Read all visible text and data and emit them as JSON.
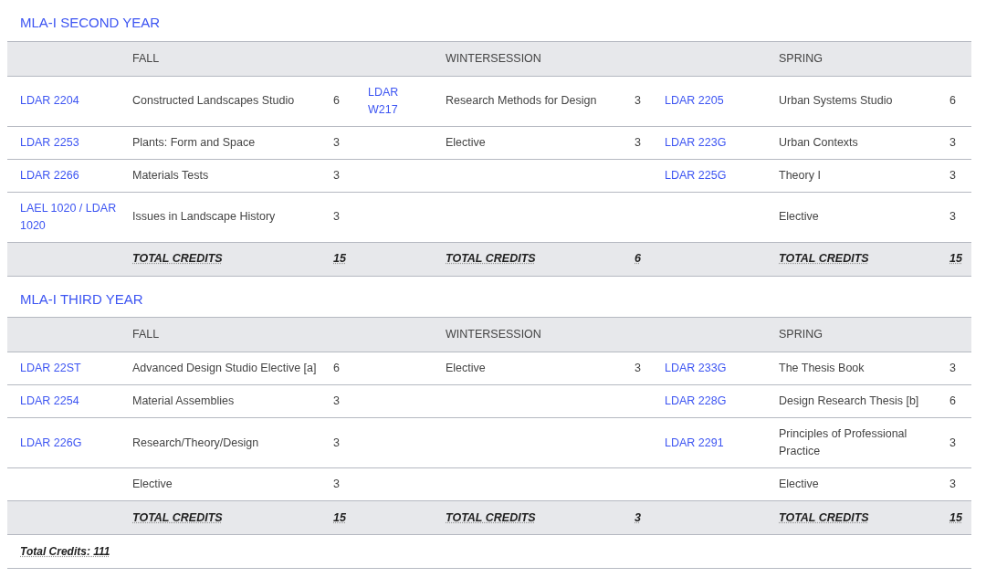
{
  "sections": [
    {
      "title": "MLA-I SECOND YEAR",
      "columns": [
        "FALL",
        "WINTERSESSION",
        "SPRING"
      ],
      "rows": [
        [
          {
            "code": "LDAR 2204",
            "title": "Constructed Landscapes Studio",
            "credits": "6"
          },
          {
            "code": "LDAR W217",
            "title": "Research Methods for Design",
            "credits": "3"
          },
          {
            "code": "LDAR 2205",
            "title": "Urban Systems Studio",
            "credits": "6"
          }
        ],
        [
          {
            "code": "LDAR 2253",
            "title": "Plants: Form and Space",
            "credits": "3"
          },
          {
            "title": "Elective",
            "credits": "3"
          },
          {
            "code": "LDAR 223G",
            "title": "Urban Contexts",
            "credits": "3"
          }
        ],
        [
          {
            "code": "LDAR 2266",
            "title": "Materials Tests",
            "credits": "3"
          },
          {},
          {
            "code": "LDAR 225G",
            "title": "Theory I",
            "credits": "3"
          }
        ],
        [
          {
            "code": "LAEL 1020 / LDAR 1020",
            "title": "Issues in Landscape History",
            "credits": "3"
          },
          {},
          {
            "title": "Elective",
            "credits": "3"
          }
        ]
      ],
      "totals": [
        {
          "label": "TOTAL CREDITS",
          "credits": "15"
        },
        {
          "label": "TOTAL CREDITS",
          "credits": "6"
        },
        {
          "label": "TOTAL CREDITS",
          "credits": "15"
        }
      ]
    },
    {
      "title": "MLA-I THIRD YEAR",
      "columns": [
        "FALL",
        "WINTERSESSION",
        "SPRING"
      ],
      "rows": [
        [
          {
            "code": "LDAR 22ST",
            "title": "Advanced Design Studio Elective [a]",
            "credits": "6"
          },
          {
            "title": "Elective",
            "credits": "3"
          },
          {
            "code": "LDAR 233G",
            "title": "The Thesis Book",
            "credits": "3"
          }
        ],
        [
          {
            "code": "LDAR 2254",
            "title": "Material Assemblies",
            "credits": "3"
          },
          {},
          {
            "code": "LDAR 228G",
            "title": "Design Research Thesis [b]",
            "credits": "6"
          }
        ],
        [
          {
            "code": "LDAR 226G",
            "title": "Research/Theory/Design",
            "credits": "3"
          },
          {},
          {
            "code": "LDAR 2291",
            "title": "Principles of Professional Practice",
            "credits": "3"
          }
        ],
        [
          {
            "title": "Elective",
            "credits": "3"
          },
          {},
          {
            "title": "Elective",
            "credits": "3"
          }
        ]
      ],
      "totals": [
        {
          "label": "TOTAL CREDITS",
          "credits": "15"
        },
        {
          "label": "TOTAL CREDITS",
          "credits": "3"
        },
        {
          "label": "TOTAL CREDITS",
          "credits": "15"
        }
      ]
    }
  ],
  "footer": "Total Credits: 111"
}
